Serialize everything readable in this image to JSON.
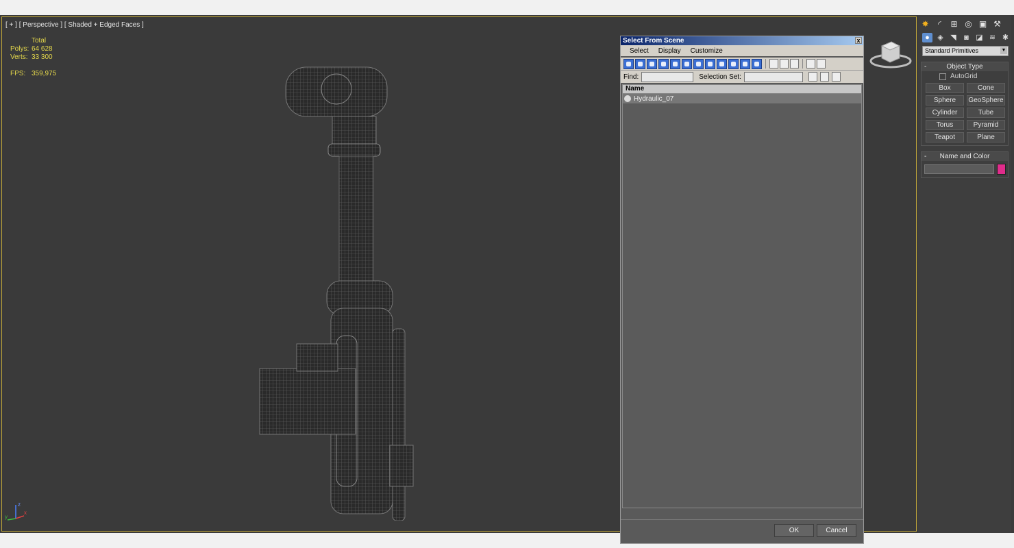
{
  "viewport": {
    "label": "[ + ] [ Perspective ] [ Shaded + Edged Faces ]",
    "stats": {
      "header": "Total",
      "polys_label": "Polys:",
      "polys_value": "64 628",
      "verts_label": "Verts:",
      "verts_value": "33 300",
      "fps_label": "FPS:",
      "fps_value": "359,975"
    },
    "gizmo_axes": [
      "z",
      "x",
      "y"
    ]
  },
  "dialog": {
    "title": "Select From Scene",
    "close_label": "x",
    "menu": [
      "Select",
      "Display",
      "Customize"
    ],
    "find_label": "Find:",
    "selection_set_label": "Selection Set:",
    "list_header": "Name",
    "items": [
      "Hydraulic_07"
    ],
    "ok_label": "OK",
    "cancel_label": "Cancel"
  },
  "command_panel": {
    "tab_icons": [
      "create-icon",
      "modify-icon",
      "hierarchy-icon",
      "motion-icon",
      "display-icon",
      "utilities-icon"
    ],
    "category_icons": [
      "geometry-icon",
      "shapes-icon",
      "lights-icon",
      "cameras-icon",
      "helpers-icon",
      "spacewarps-icon",
      "systems-icon"
    ],
    "dropdown_value": "Standard Primitives",
    "object_type": {
      "title": "Object Type",
      "autogrid_label": "AutoGrid",
      "buttons": [
        "Box",
        "Cone",
        "Sphere",
        "GeoSphere",
        "Cylinder",
        "Tube",
        "Torus",
        "Pyramid",
        "Teapot",
        "Plane"
      ]
    },
    "name_and_color": {
      "title": "Name and Color",
      "color": "#e02c8b"
    }
  },
  "colors": {
    "viewport_border": "#c2a83a",
    "stats_text": "#e5d84b",
    "title_bar": "#0a246a"
  }
}
